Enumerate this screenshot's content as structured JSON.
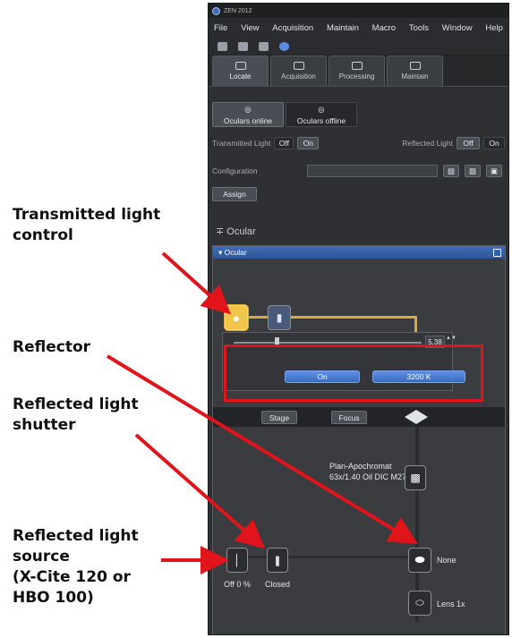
{
  "app": {
    "title": "ZEN 2012",
    "menu": [
      "File",
      "View",
      "Acquisition",
      "Maintain",
      "Macro",
      "Tools",
      "Window",
      "Help"
    ],
    "tabs": [
      {
        "label": "Locate",
        "icon": "locate-icon",
        "active": true
      },
      {
        "label": "Acquisition",
        "icon": "acquisition-icon",
        "active": false
      },
      {
        "label": "Processing",
        "icon": "processing-icon",
        "active": false
      },
      {
        "label": "Maintain",
        "icon": "maintain-icon",
        "active": false
      }
    ],
    "oculars_online": "Oculars online",
    "oculars_offline": "Oculars offline",
    "transmitted_light_label": "Transmitted Light",
    "reflected_light_label": "Reflected Light",
    "off": "Off",
    "on": "On",
    "configuration_label": "Configuration",
    "assign_button": "Assign",
    "ocular_section": "Ocular",
    "ocular_panel_title": "Ocular",
    "intensity_value": "5.38",
    "light_on_button": "On",
    "color_temp_button": "3200 K",
    "stage_button": "Stage",
    "focus_button": "Focus",
    "objective_label": "Plan-Apochromat 63x/1.40 Oil DIC M27",
    "reflector_label": "None",
    "tube_lens_label": "Lens 1x",
    "rl_source_label": "Off 0 %",
    "rl_shutter_label": "Closed",
    "accent_color": "#d9a93a",
    "highlight_color": "#e1141c"
  },
  "callouts": {
    "transmitted": [
      "Transmitted light",
      "control"
    ],
    "reflector": "Reflector",
    "shutter": [
      "Reflected light",
      "shutter"
    ],
    "source": [
      "Reflected light",
      "source",
      "(X-Cite 120 or",
      "HBO 100)"
    ]
  }
}
